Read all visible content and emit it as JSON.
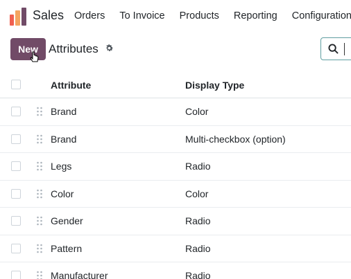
{
  "app": {
    "name": "Sales",
    "brand_colors": [
      "#f06050",
      "#f4a460",
      "#714b67"
    ]
  },
  "menu": {
    "items": [
      "Orders",
      "To Invoice",
      "Products",
      "Reporting",
      "Configuration"
    ]
  },
  "control_panel": {
    "new_label": "New",
    "title": "Attributes",
    "accent": "#714b67"
  },
  "table": {
    "headers": {
      "attribute": "Attribute",
      "display_type": "Display Type"
    },
    "rows": [
      {
        "attribute": "Brand",
        "display_type": "Color"
      },
      {
        "attribute": "Brand",
        "display_type": "Multi-checkbox (option)"
      },
      {
        "attribute": "Legs",
        "display_type": "Radio"
      },
      {
        "attribute": "Color",
        "display_type": "Color"
      },
      {
        "attribute": "Gender",
        "display_type": "Radio"
      },
      {
        "attribute": "Pattern",
        "display_type": "Radio"
      },
      {
        "attribute": "Manufacturer",
        "display_type": "Radio"
      }
    ]
  }
}
